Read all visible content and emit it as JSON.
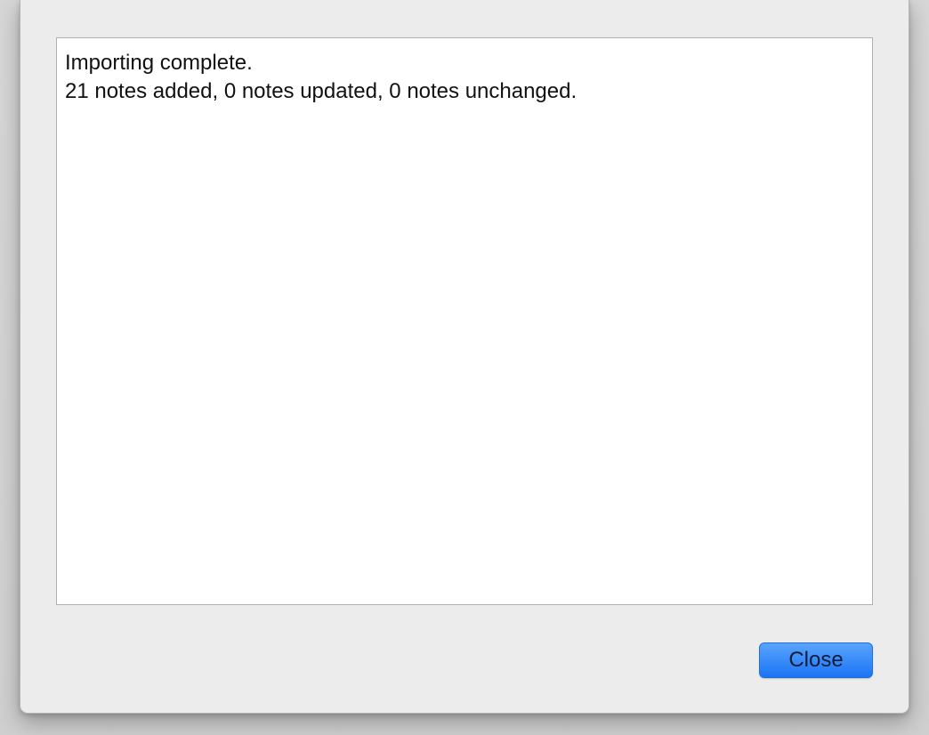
{
  "dialog": {
    "log_lines": [
      "Importing complete.",
      "21 notes added, 0 notes updated, 0 notes unchanged."
    ],
    "close_label": "Close"
  },
  "colors": {
    "sheet_background": "#ececec",
    "log_background": "#ffffff",
    "button_accent": "#1a74f3"
  }
}
